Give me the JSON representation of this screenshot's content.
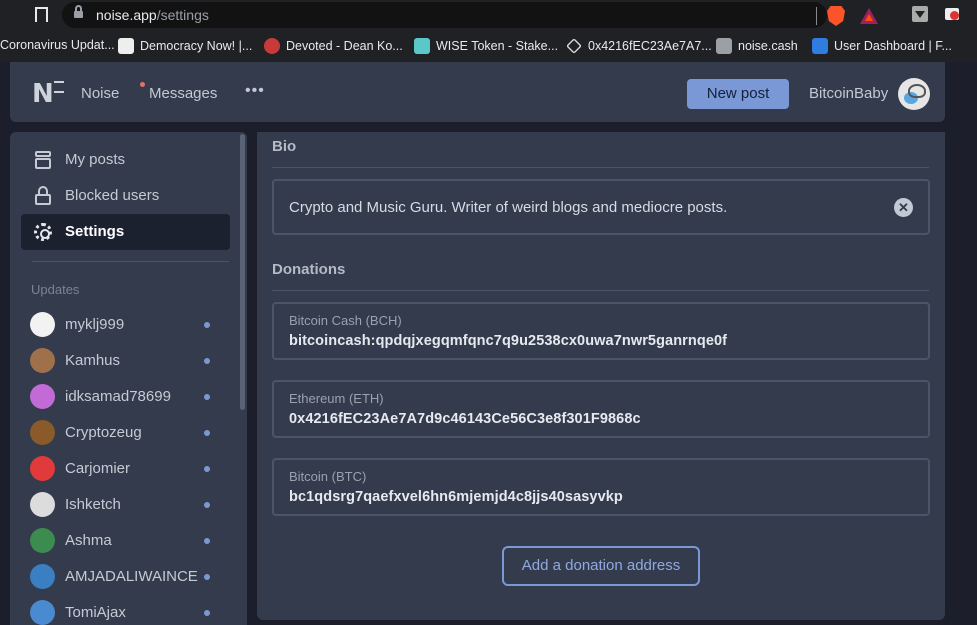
{
  "browser": {
    "url_host": "noise.app",
    "url_path": "/settings",
    "bookmarks": [
      {
        "label": "Coronavirus Updat...",
        "icon": "globe-icon"
      },
      {
        "label": "Democracy Now! |...",
        "icon": "democracy-now-icon"
      },
      {
        "label": "Devoted - Dean Ko...",
        "icon": "devoted-icon"
      },
      {
        "label": "WISE Token - Stake...",
        "icon": "wise-token-icon"
      },
      {
        "label": "0x4216fEC23Ae7A7...",
        "icon": "ethereum-icon"
      },
      {
        "label": "noise.cash",
        "icon": "noise-icon"
      },
      {
        "label": "User Dashboard | F...",
        "icon": "fp-icon"
      }
    ]
  },
  "topnav": {
    "logo_text": "N",
    "noise_label": "Noise",
    "messages_label": "Messages",
    "more_label": "•••",
    "new_post_label": "New post",
    "username": "BitcoinBaby"
  },
  "sidebar": {
    "menu": [
      {
        "label": "My posts",
        "icon": "stack-icon"
      },
      {
        "label": "Blocked users",
        "icon": "lock-icon"
      },
      {
        "label": "Settings",
        "icon": "gear-icon",
        "active": true
      }
    ],
    "updates_heading": "Updates",
    "updates": [
      {
        "name": "myklj999",
        "avatar_color": "#f2f2f2"
      },
      {
        "name": "Kamhus",
        "avatar_color": "#a0704a"
      },
      {
        "name": "idksamad78699",
        "avatar_color": "#c26bd6"
      },
      {
        "name": "Cryptozeug",
        "avatar_color": "#8a5a2b"
      },
      {
        "name": "Carjomier",
        "avatar_color": "#e03a3a"
      },
      {
        "name": "Ishketch",
        "avatar_color": "#dcdcdc"
      },
      {
        "name": "Ashma",
        "avatar_color": "#3d8c4f"
      },
      {
        "name": "AMJADALIWAINCE",
        "avatar_color": "#3a7fc1"
      },
      {
        "name": "TomiAjax",
        "avatar_color": "#4a8ad1"
      }
    ]
  },
  "main": {
    "bio_heading": "Bio",
    "bio_text": "Crypto and Music Guru. Writer of weird blogs and mediocre posts.",
    "clear_icon": "✕",
    "donations_heading": "Donations",
    "donations": [
      {
        "label": "Bitcoin Cash (BCH)",
        "address": "bitcoincash:qpdqjxegqmfqnc7q9u2538cx0uwa7nwr5ganrnqe0f"
      },
      {
        "label": "Ethereum (ETH)",
        "address": "0x4216fEC23Ae7A7d9c46143Ce56C3e8f301F9868c"
      },
      {
        "label": "Bitcoin (BTC)",
        "address": "bc1qdsrg7qaefxvel6hn6mjemjd4c8jjs40sasyvkp"
      }
    ],
    "add_donation_label": "Add a donation address"
  },
  "colors": {
    "accent": "#7b98d6",
    "panel": "#343b4d",
    "background": "#1c1f2b"
  }
}
